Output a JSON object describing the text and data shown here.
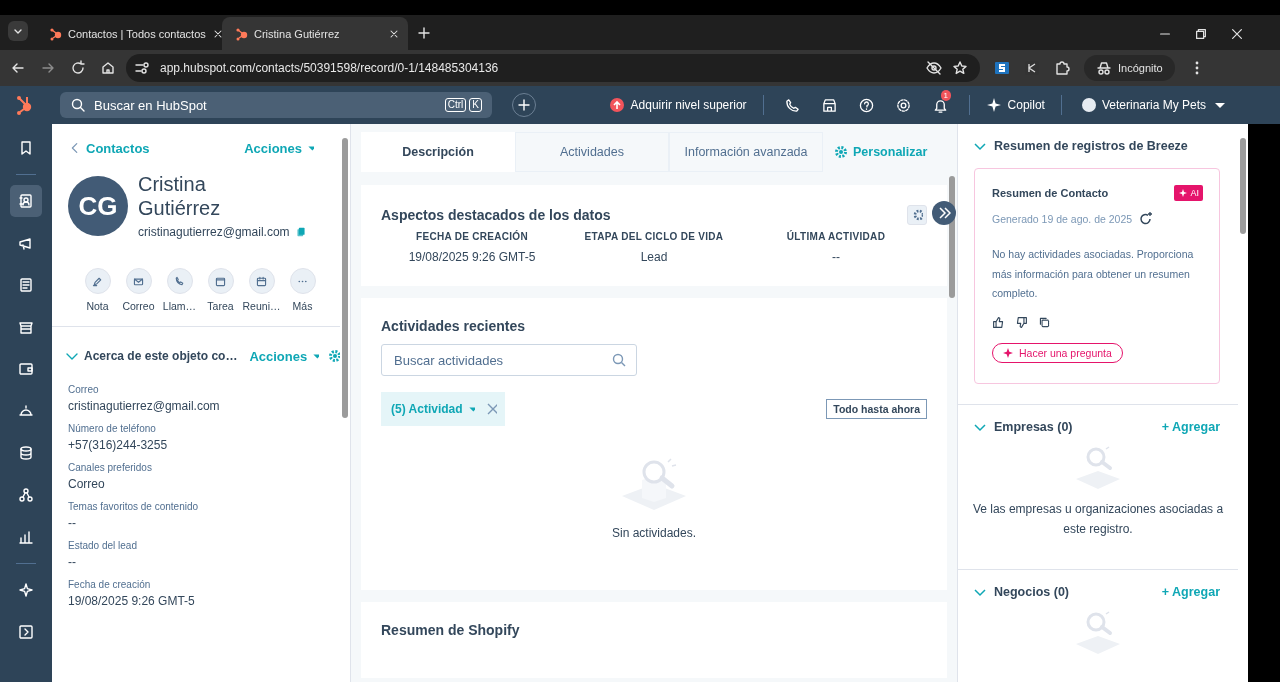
{
  "browser": {
    "tabs": [
      {
        "title": "Contactos | Todos contactos",
        "selected": false
      },
      {
        "title": "Cristina Gutiérrez",
        "selected": true
      }
    ],
    "url": "app.hubspot.com/contacts/50391598/record/0-1/148485304136",
    "profile": "Incógnito"
  },
  "topnav": {
    "search_placeholder": "Buscar en HubSpot",
    "shortcut": [
      "Ctrl",
      "K"
    ],
    "upgrade": "Adquirir nivel superior",
    "notification_count": "1",
    "copilot": "Copilot",
    "account": "Veterinaria My Pets"
  },
  "sidebar": {
    "items": [
      {
        "selected": false
      },
      {
        "selected": true
      },
      {
        "selected": false
      },
      {
        "selected": false
      },
      {
        "selected": false
      },
      {
        "selected": false
      },
      {
        "selected": false
      },
      {
        "selected": false
      },
      {
        "selected": false
      },
      {
        "selected": false
      },
      {
        "selected": false
      },
      {
        "selected": false
      }
    ]
  },
  "contact": {
    "back_link": "Contactos",
    "actions": "Acciones",
    "initials": "CG",
    "name": "Cristina Gutiérrez",
    "email": "cristinagutierrez@gmail.com",
    "quick_actions": [
      "Nota",
      "Correo",
      "Llam…",
      "Tarea",
      "Reuni…",
      "Más"
    ],
    "about": {
      "title": "Acerca de este objeto co…",
      "actions": "Acciones",
      "expanded": true,
      "fields": [
        {
          "label": "Correo",
          "value": "cristinagutierrez@gmail.com"
        },
        {
          "label": "Número de teléfono",
          "value": "+57(316)244-3255"
        },
        {
          "label": "Canales preferidos",
          "value": "Correo"
        },
        {
          "label": "Temas favoritos de contenido",
          "value": "--"
        },
        {
          "label": "Estado del lead",
          "value": "--"
        },
        {
          "label": "Fecha de creación",
          "value": "19/08/2025 9:26 GMT-5"
        }
      ]
    }
  },
  "record_tabs": [
    {
      "label": "Descripción",
      "selected": true
    },
    {
      "label": "Actividades",
      "selected": false
    },
    {
      "label": "Información avanzada",
      "selected": false
    }
  ],
  "customize": "Personalizar",
  "highlights": {
    "title": "Aspectos destacados de los datos",
    "columns": [
      {
        "label": "FECHA DE CREACIÓN",
        "value": "19/08/2025 9:26 GMT-5"
      },
      {
        "label": "ETAPA DEL CICLO DE VIDA",
        "value": "Lead"
      },
      {
        "label": "ÚLTIMA ACTIVIDAD",
        "value": "--"
      }
    ]
  },
  "recent": {
    "title": "Actividades recientes",
    "search_placeholder": "Buscar actividades",
    "filter": "(5) Actividad",
    "range": "Todo hasta ahora",
    "empty": "Sin actividades."
  },
  "shopify": {
    "title": "Resumen de Shopify"
  },
  "breeze": {
    "title": "Resumen de registros de Breeze",
    "expanded": true,
    "card": {
      "title": "Resumen de Contacto",
      "badge": "AI",
      "generated": "Generado 19 de ago. de 2025",
      "body": "No hay actividades asociadas. Proporciona más información para obtener un resumen completo.",
      "ask": "Hacer una pregunta"
    }
  },
  "associations": [
    {
      "title": "Empresas (0)",
      "add": "+ Agregar",
      "expanded": true,
      "empty": "Ve las empresas u organizaciones asociadas a este registro."
    },
    {
      "title": "Negocios (0)",
      "add": "+ Agregar",
      "expanded": true
    }
  ]
}
